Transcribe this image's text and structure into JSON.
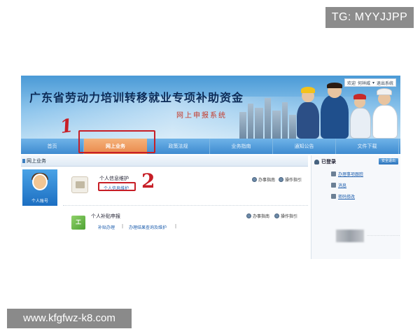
{
  "watermarks": {
    "top_right": "TG: MYYJJPP",
    "bottom_left": "www.kfgfwz-k8.com"
  },
  "banner": {
    "title": "广东省劳动力培训转移就业专项补助资金",
    "subtitle": "网上申报系统",
    "top_links": [
      "欢迎",
      "何祥威",
      "▾",
      "退出系统"
    ]
  },
  "nav": {
    "items": [
      {
        "label": "首页",
        "active": false
      },
      {
        "label": "网上业务",
        "active": true
      },
      {
        "label": "政策法规",
        "active": false
      },
      {
        "label": "业务指南",
        "active": false
      },
      {
        "label": "通知公告",
        "active": false
      },
      {
        "label": "文件下载",
        "active": false
      }
    ]
  },
  "annotations": {
    "mark1": "1",
    "mark2": "2",
    "color": "#c71e26"
  },
  "section": {
    "header": "网上业务",
    "avatar_label": "个人账号"
  },
  "blocks": {
    "personal_info": {
      "title": "个人信息维护",
      "link": "个人信息维护",
      "action1": "办事指南",
      "action2": "操作指引"
    },
    "subsidy": {
      "title": "个人补贴申报",
      "link1": "补贴办理",
      "sep": "|",
      "link2": "办理结果查询及维护",
      "sep2": "|",
      "action1": "办事指南",
      "action2": "操作指引"
    }
  },
  "right_panel": {
    "title": "已登录",
    "logout": "安全退出",
    "items": [
      "办理事项跟踪",
      "消息",
      "密码修改"
    ]
  },
  "blurred": {
    "text": "·····································"
  },
  "colors": {
    "nav_active": "#e9874a",
    "nav_bg": "#3e8bd0",
    "link": "#1f5fae"
  }
}
